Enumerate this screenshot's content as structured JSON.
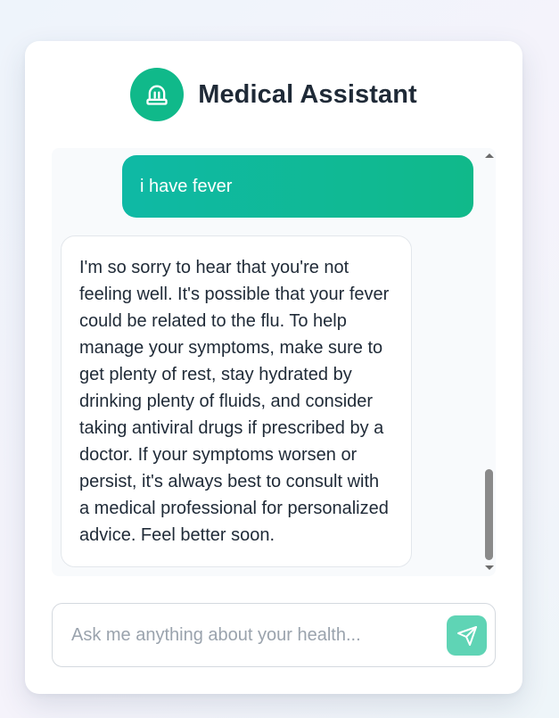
{
  "header": {
    "title": "Medical Assistant",
    "logo_icon": "medical-helmet-icon"
  },
  "chat": {
    "messages": [
      {
        "role": "user",
        "text": "i have fever"
      },
      {
        "role": "assistant",
        "text": "I'm so sorry to hear that you're not feeling well. It's possible that your fever could be related to the flu. To help manage your symptoms, make sure to get plenty of rest, stay hydrated by drinking plenty of fluids, and consider taking antiviral drugs if prescribed by a doctor. If your symptoms worsen or persist, it's always best to consult with a medical professional for personalized advice. Feel better soon."
      }
    ]
  },
  "composer": {
    "value": "",
    "placeholder": "Ask me anything about your health...",
    "send_icon": "send-icon"
  },
  "colors": {
    "accent": "#10b98a",
    "accent_light": "#5fd4b5",
    "text": "#1f2a37",
    "placeholder": "#9aa3ad"
  }
}
